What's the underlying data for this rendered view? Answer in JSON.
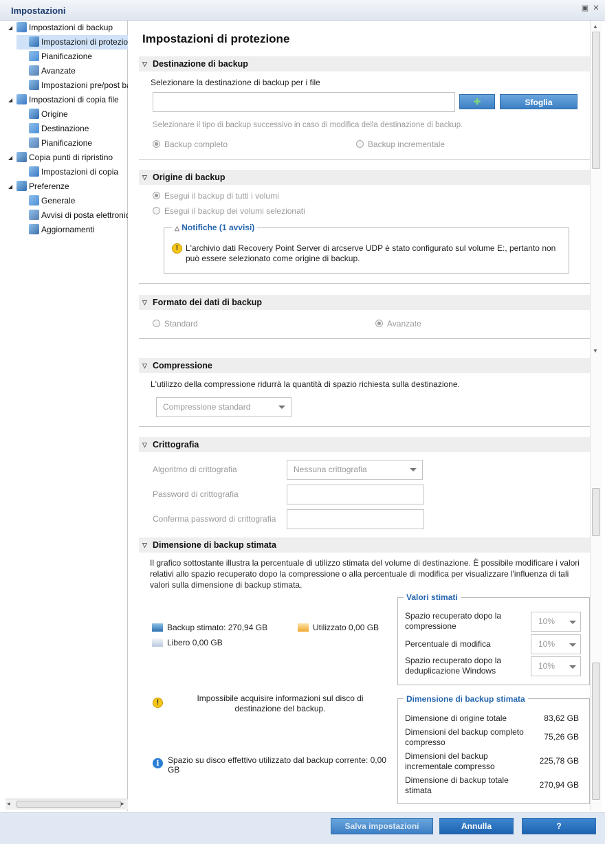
{
  "window": {
    "title": "Impostazioni"
  },
  "tree": [
    {
      "label": "Impostazioni di backup",
      "level": 0,
      "icon": "backup-settings-icon"
    },
    {
      "label": "Impostazioni di protezione",
      "level": 1,
      "icon": "protection-icon",
      "selected": true
    },
    {
      "label": "Pianificazione",
      "level": 1,
      "icon": "schedule-icon"
    },
    {
      "label": "Avanzate",
      "level": 1,
      "icon": "advanced-icon"
    },
    {
      "label": "Impostazioni pre/post backup",
      "level": 1,
      "icon": "wrench-icon"
    },
    {
      "label": "Impostazioni di copia file",
      "level": 0,
      "icon": "file-copy-icon"
    },
    {
      "label": "Origine",
      "level": 1,
      "icon": "source-icon"
    },
    {
      "label": "Destinazione",
      "level": 1,
      "icon": "destination-icon"
    },
    {
      "label": "Pianificazione",
      "level": 1,
      "icon": "schedule-icon"
    },
    {
      "label": "Copia punti di ripristino",
      "level": 0,
      "icon": "recovery-copy-icon"
    },
    {
      "label": "Impostazioni di copia",
      "level": 1,
      "icon": "copy-settings-icon"
    },
    {
      "label": "Preferenze",
      "level": 0,
      "icon": "preferences-icon"
    },
    {
      "label": "Generale",
      "level": 1,
      "icon": "general-icon"
    },
    {
      "label": "Avvisi di posta elettronica",
      "level": 1,
      "icon": "email-icon"
    },
    {
      "label": "Aggiornamenti",
      "level": 1,
      "icon": "updates-icon"
    }
  ],
  "main": {
    "title": "Impostazioni di protezione",
    "dest": {
      "header": "Destinazione di backup",
      "prompt": "Selezionare la destinazione di backup per i file",
      "path_value": "",
      "browse_label": "Sfoglia",
      "type_prompt": "Selezionare il tipo di backup successivo in caso di modifica della destinazione di backup.",
      "full_label": "Backup completo",
      "incr_label": "Backup incrementale"
    },
    "origin": {
      "header": "Origine di backup",
      "all_label": "Esegui il backup di tutti i volumi",
      "sel_label": "Esegui il backup dei volumi selezionati",
      "notif_title": "Notifiche (1 avvisi)",
      "notif_text": "L'archivio dati Recovery Point Server di arcserve UDP è stato configurato sul volume E:, pertanto non può essere selezionato come origine di backup."
    },
    "format": {
      "header": "Formato dei dati di backup",
      "std_label": "Standard",
      "adv_label": "Avanzate"
    },
    "compression": {
      "header": "Compressione",
      "desc": "L'utilizzo della compressione ridurrà la quantità di spazio richiesta sulla destinazione.",
      "value": "Compressione standard"
    },
    "encryption": {
      "header": "Crittografia",
      "algo_label": "Algoritmo di crittografia",
      "algo_value": "Nessuna crittografia",
      "pwd_label": "Password di crittografia",
      "confirm_label": "Conferma password di crittografia"
    },
    "estimate": {
      "header": "Dimensione di backup stimata",
      "desc": "Il grafico sottostante illustra la percentuale di utilizzo stimata del volume di destinazione. È possibile modificare i valori relativi allo spazio recuperato dopo la compressione o alla percentuale di modifica per visualizzare l'influenza di tali valori sulla dimensione di backup stimata.",
      "legend_backup": "Backup stimato: 270,94 GB",
      "legend_used": "Utilizzato 0,00 GB",
      "legend_free": "Libero 0,00 GB",
      "warn_text": "Impossibile acquisire informazioni sul disco di destinazione del backup.",
      "info_text": "Spazio su disco effettivo utilizzato dal backup corrente: 0,00 GB",
      "values_title": "Valori stimati",
      "v1_label": "Spazio recuperato dopo la compressione",
      "v1_value": "10%",
      "v2_label": "Percentuale di modifica",
      "v2_value": "10%",
      "v3_label": "Spazio recuperato dopo la deduplicazione Windows",
      "v3_value": "10%",
      "size_title": "Dimensione di backup stimata",
      "s1_label": "Dimensione di origine totale",
      "s1_value": "83,62 GB",
      "s2_label": "Dimensioni del backup completo compresso",
      "s2_value": "75,26 GB",
      "s3_label": "Dimensioni del backup incrementale compresso",
      "s3_value": "225,78 GB",
      "s4_label": "Dimensione di backup totale stimata",
      "s4_value": "270,94 GB"
    }
  },
  "footer": {
    "save": "Salva impostazioni",
    "cancel": "Annulla",
    "help": "?"
  },
  "colors": {
    "accent": "#2565ae",
    "button": "#3c7fc4",
    "selected": "#cfe2f7"
  }
}
